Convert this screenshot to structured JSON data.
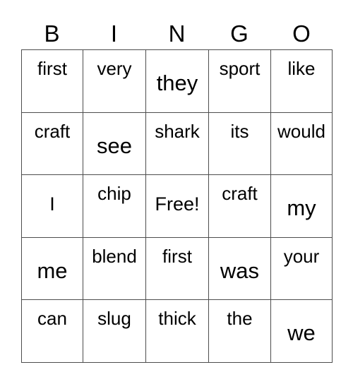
{
  "card": {
    "type": "bingo-card",
    "columns": 5,
    "rows": 5,
    "free_space": "Free!",
    "free_space_position": {
      "row": 3,
      "column": 3
    },
    "border_color": "#4d4d4d",
    "background_color": "#ffffff",
    "text_color": "#000000"
  },
  "header": {
    "letters": [
      {
        "label": "B"
      },
      {
        "label": "I"
      },
      {
        "label": "N"
      },
      {
        "label": "G"
      },
      {
        "label": "O"
      }
    ]
  },
  "grid": {
    "rows": [
      {
        "cells": [
          {
            "text": "first",
            "size": "sm"
          },
          {
            "text": "very",
            "size": "sm"
          },
          {
            "text": "they",
            "size": "lg"
          },
          {
            "text": "sport",
            "size": "sm"
          },
          {
            "text": "like",
            "size": "sm"
          }
        ]
      },
      {
        "cells": [
          {
            "text": "craft",
            "size": "sm"
          },
          {
            "text": "see",
            "size": "lg"
          },
          {
            "text": "shark",
            "size": "sm"
          },
          {
            "text": "its",
            "size": "sm"
          },
          {
            "text": "would",
            "size": "sm"
          }
        ]
      },
      {
        "cells": [
          {
            "text": "I",
            "size": "md"
          },
          {
            "text": "chip",
            "size": "sm"
          },
          {
            "text": "Free!",
            "size": "md"
          },
          {
            "text": "craft",
            "size": "sm"
          },
          {
            "text": "my",
            "size": "lg"
          }
        ]
      },
      {
        "cells": [
          {
            "text": "me",
            "size": "lg"
          },
          {
            "text": "blend",
            "size": "sm"
          },
          {
            "text": "first",
            "size": "sm"
          },
          {
            "text": "was",
            "size": "lg"
          },
          {
            "text": "your",
            "size": "sm"
          }
        ]
      },
      {
        "cells": [
          {
            "text": "can",
            "size": "sm"
          },
          {
            "text": "slug",
            "size": "sm"
          },
          {
            "text": "thick",
            "size": "sm"
          },
          {
            "text": "the",
            "size": "sm"
          },
          {
            "text": "we",
            "size": "lg"
          }
        ]
      }
    ]
  }
}
